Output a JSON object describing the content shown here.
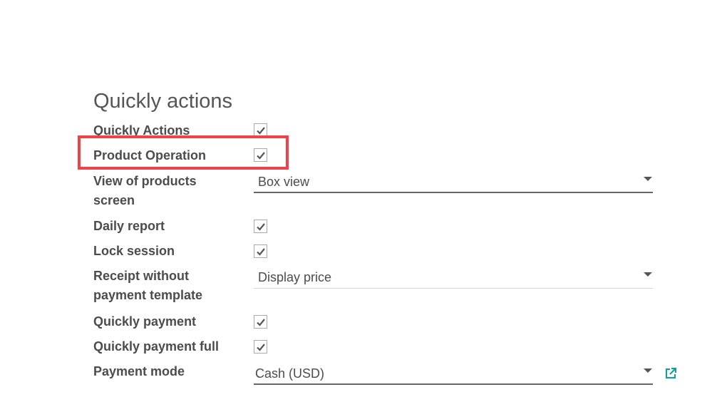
{
  "section": {
    "title": "Quickly actions"
  },
  "fields": {
    "quickly_actions": {
      "label": "Quickly Actions",
      "checked": true
    },
    "product_operation": {
      "label": "Product Operation",
      "checked": true
    },
    "view_of_products_screen": {
      "label_line1": "View of products",
      "label_line2": "screen",
      "value": "Box view"
    },
    "daily_report": {
      "label": "Daily report",
      "checked": true
    },
    "lock_session": {
      "label": "Lock session",
      "checked": true
    },
    "receipt_without_payment_template": {
      "label_line1": "Receipt without",
      "label_line2": "payment template",
      "value": "Display price"
    },
    "quickly_payment": {
      "label": "Quickly payment",
      "checked": true
    },
    "quickly_payment_full": {
      "label": "Quickly payment full",
      "checked": true
    },
    "payment_mode": {
      "label": "Payment mode",
      "value": "Cash (USD)"
    }
  },
  "colors": {
    "highlight": "#f0424a",
    "link_icon": "#1a9e8f",
    "check": "#555555"
  },
  "icons": {
    "checkbox_mark": "check-icon",
    "dropdown": "caret-down-icon",
    "external_link": "external-link-icon"
  }
}
